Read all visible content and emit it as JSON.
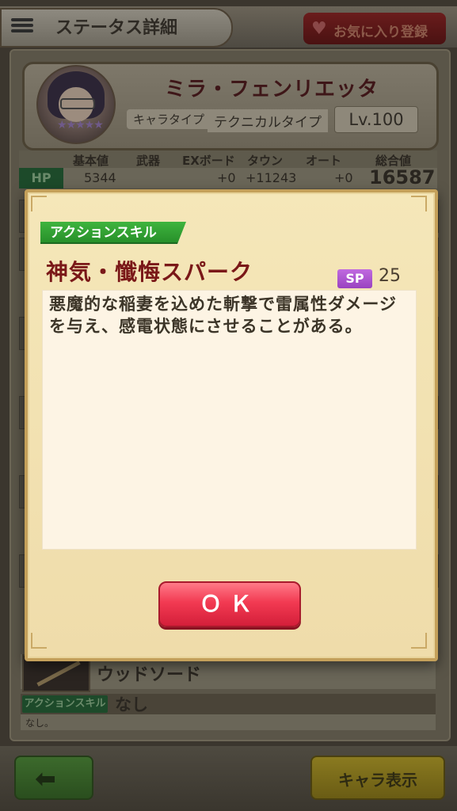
{
  "header": {
    "title": "ステータス詳細",
    "favorite_label": "お気に入り登録",
    "menu_icon": "menu-icon",
    "heart_icon": "heart-icon"
  },
  "profile": {
    "name": "ミラ・フェンリエッタ",
    "type_label": "キャラタイプ",
    "type_value": "テクニカルタイプ",
    "level": "Lv.100",
    "stars": "★★★★★"
  },
  "stats": {
    "headers": [
      "基本値",
      "武器",
      "EXボード",
      "タウン",
      "オート",
      "総合値"
    ],
    "hp": {
      "label": "HP",
      "base": "5344",
      "weapon": "",
      "exboard": "+0",
      "town": "+11243",
      "auto": "+0",
      "total": "16587"
    }
  },
  "weapon": {
    "name": "ウッドソード",
    "skill_tag": "アクションスキル",
    "skill_name": "なし",
    "skill_desc": "なし。"
  },
  "footer": {
    "back_icon": "back-arrow-icon",
    "back_glyph": "⬅",
    "chara_button": "キャラ表示"
  },
  "dialog": {
    "tag": "アクションスキル",
    "skill_name": "神気・懺悔スパーク",
    "sp_label": "SP",
    "sp_value": "25",
    "description": "悪魔的な稲妻を込めた斬撃で雷属性ダメージを与え、感電状態にさせることがある。",
    "ok_label": "ＯＫ"
  },
  "colors": {
    "dialog_bg": "#f5e7b9",
    "tag_green": "#3fb43e",
    "title_red": "#7a1818",
    "sp_purple": "#b45ad6",
    "ok_red": "#f23a52"
  }
}
